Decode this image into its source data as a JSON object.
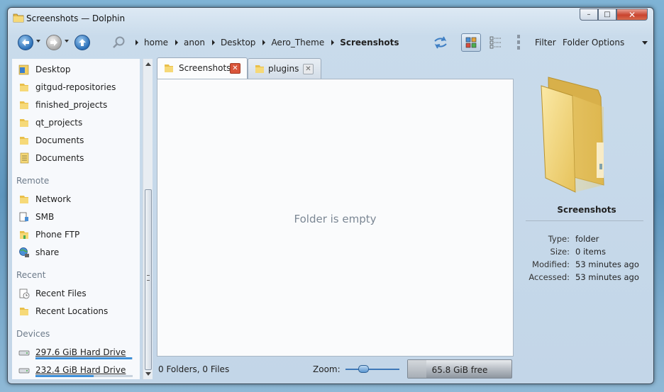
{
  "window": {
    "title": "Screenshots — Dolphin",
    "controls": {
      "minimize": "–",
      "maximize": "□",
      "close": "✕"
    }
  },
  "toolbar": {
    "breadcrumb": [
      "home",
      "anon",
      "Desktop",
      "Aero_Theme",
      "Screenshots"
    ],
    "filter_label": "Filter",
    "folder_options_label": "Folder Options"
  },
  "sidebar": {
    "places": [
      {
        "label": "Desktop",
        "icon": "desktop-folder-icon"
      },
      {
        "label": "gitgud-repositories",
        "icon": "folder-icon"
      },
      {
        "label": "finished_projects",
        "icon": "folder-icon"
      },
      {
        "label": "qt_projects",
        "icon": "folder-icon"
      },
      {
        "label": "Documents",
        "icon": "folder-icon"
      },
      {
        "label": "Documents",
        "icon": "documents-folder-icon"
      }
    ],
    "remote_header": "Remote",
    "remote": [
      {
        "label": "Network",
        "icon": "folder-icon"
      },
      {
        "label": "SMB",
        "icon": "network-share-icon"
      },
      {
        "label": "Phone FTP",
        "icon": "ftp-folder-icon"
      },
      {
        "label": "share",
        "icon": "network-globe-icon"
      }
    ],
    "recent_header": "Recent",
    "recent": [
      {
        "label": "Recent Files",
        "icon": "recent-files-icon"
      },
      {
        "label": "Recent Locations",
        "icon": "folder-icon"
      }
    ],
    "devices_header": "Devices",
    "devices": [
      {
        "label": "297.6 GiB Hard Drive",
        "icon": "hard-drive-icon",
        "usage_fraction": 0.99
      },
      {
        "label": "232.4 GiB Hard Drive",
        "icon": "hard-drive-icon",
        "usage_fraction": 0.6
      }
    ]
  },
  "tabs": [
    {
      "label": "Screenshots",
      "active": true
    },
    {
      "label": "plugins",
      "active": false
    }
  ],
  "content": {
    "empty_message": "Folder is empty"
  },
  "statusbar": {
    "summary": "0 Folders, 0 Files",
    "zoom_label": "Zoom:",
    "zoom_level": 0.3,
    "free_space": "65.8 GiB free",
    "used_fraction": 0.18
  },
  "info": {
    "title": "Screenshots",
    "rows": [
      {
        "key": "Type:",
        "value": "folder"
      },
      {
        "key": "Size:",
        "value": "0 items"
      },
      {
        "key": "Modified:",
        "value": "53 minutes ago"
      },
      {
        "key": "Accessed:",
        "value": "53 minutes ago"
      }
    ]
  },
  "colors": {
    "accent": "#3d8fd8",
    "folder": "#f2cf62",
    "close_red": "#d9553a"
  }
}
